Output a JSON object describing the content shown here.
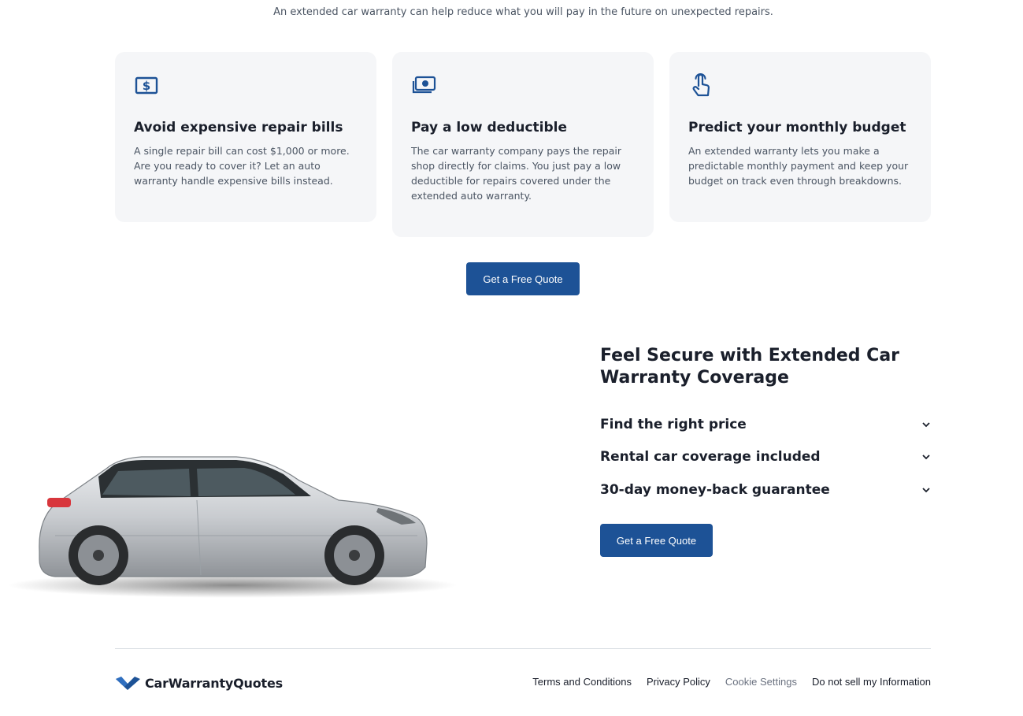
{
  "intro": "An extended car warranty can help reduce what you will pay in the future on unexpected repairs.",
  "cards": [
    {
      "icon": "dollar-bill-icon",
      "title": "Avoid expensive repair bills",
      "body": "A single repair bill can cost $1,000 or more. Are you ready to cover it? Let an auto warranty handle expensive bills instead."
    },
    {
      "icon": "cash-stack-icon",
      "title": "Pay a low deductible",
      "body": "The car warranty company pays the repair shop directly for claims. You just pay a low deductible for repairs covered under the extended auto warranty."
    },
    {
      "icon": "hand-pointer-icon",
      "title": "Predict your monthly budget",
      "body": "An extended warranty lets you make a predictable monthly payment and keep your budget on track even through breakdowns."
    }
  ],
  "cta": {
    "quote_label": "Get a Free Quote"
  },
  "secure": {
    "title": "Feel Secure with Extended Car Warranty Coverage",
    "faq": [
      "Find the right price",
      "Rental car coverage included",
      "30-day money-back guarantee"
    ]
  },
  "footer": {
    "logo_text": "CarWarrantyQuotes",
    "links": [
      "Terms and Conditions",
      "Privacy Policy",
      "Cookie Settings",
      "Do not sell my Information"
    ]
  },
  "colors": {
    "primary": "#1d5296",
    "card_bg": "#f5f6f8",
    "heading": "#1a1f2b"
  }
}
